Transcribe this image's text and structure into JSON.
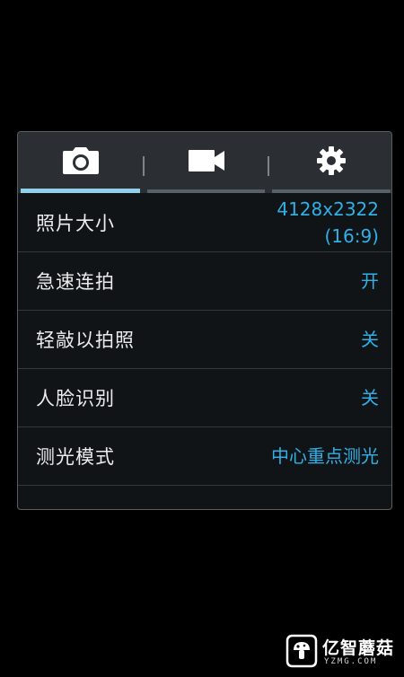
{
  "tabs": [
    {
      "icon": "camera-icon",
      "active": true
    },
    {
      "icon": "video-camera-icon",
      "active": false
    },
    {
      "icon": "gear-icon",
      "active": false
    }
  ],
  "settings": [
    {
      "label": "照片大小",
      "value_line1": "4128x2322",
      "value_line2": "(16:9)"
    },
    {
      "label": "急速连拍",
      "value": "开"
    },
    {
      "label": "轻敲以拍照",
      "value": "关"
    },
    {
      "label": "人脸识别",
      "value": "关"
    },
    {
      "label": "测光模式",
      "value": "中心重点测光"
    }
  ],
  "watermark": {
    "name": "亿智蘑菇",
    "domain": "YZMG.COM"
  },
  "colors": {
    "accent": "#2fb0e6",
    "active_tab_underline": "#8fd0ec",
    "panel_bg": "#101417",
    "tabbar_bg": "#2b2e32"
  }
}
